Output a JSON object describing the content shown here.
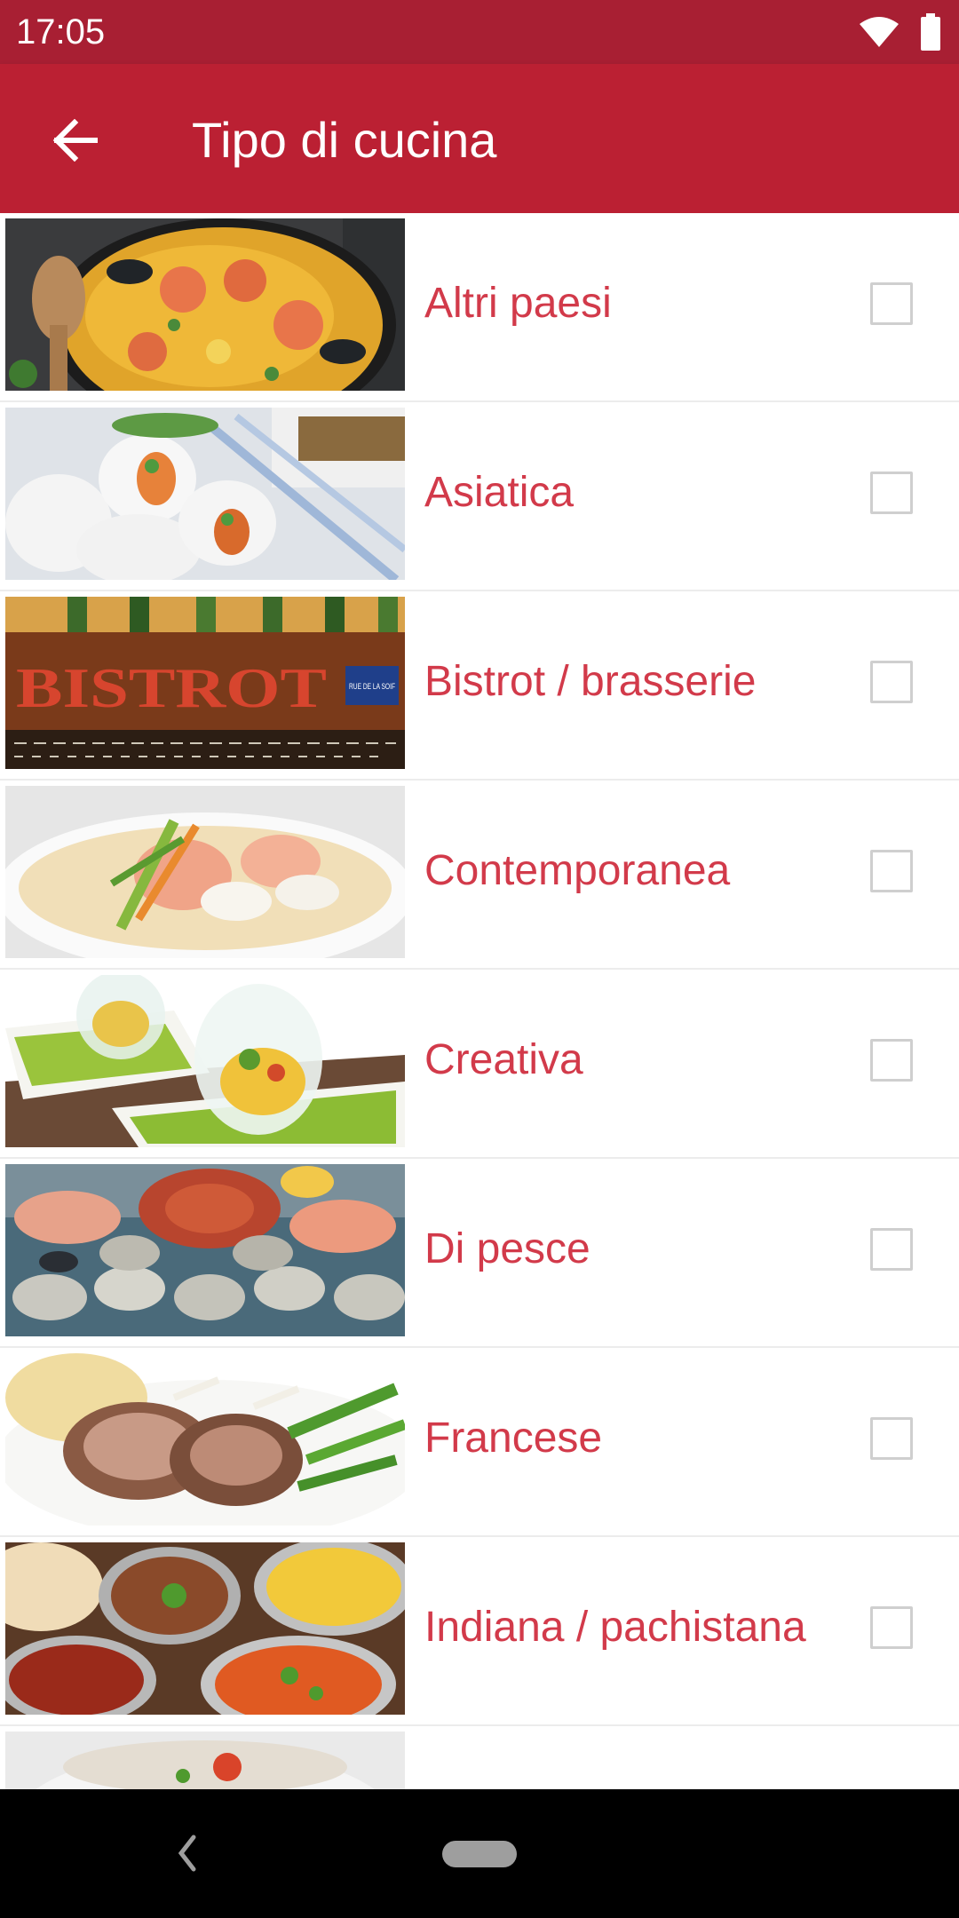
{
  "status_bar": {
    "time": "17:05",
    "icons": [
      "wifi-icon",
      "battery-icon"
    ]
  },
  "app_bar": {
    "back_icon": "arrow-back-icon",
    "title": "Tipo di cucina"
  },
  "items": [
    {
      "label": "Altri paesi",
      "checked": false
    },
    {
      "label": "Asiatica",
      "checked": false
    },
    {
      "label": "Bistrot / brasserie",
      "checked": false
    },
    {
      "label": "Contemporanea",
      "checked": false
    },
    {
      "label": "Creativa",
      "checked": false
    },
    {
      "label": "Di pesce",
      "checked": false
    },
    {
      "label": "Francese",
      "checked": false
    },
    {
      "label": "Indiana / pachistana",
      "checked": false
    },
    {
      "label": "",
      "checked": false
    }
  ],
  "bistrot_sign": {
    "sign": "BISTROT",
    "plate": "RUE DE LA SOIF"
  },
  "colors": {
    "status_bar": "#a81f33",
    "app_bar": "#bb2033",
    "label_text": "#d23a4a",
    "checkbox_border": "#cfcfcf"
  },
  "nav_bar": {
    "icons": [
      "nav-back-icon",
      "nav-home-pill"
    ]
  }
}
